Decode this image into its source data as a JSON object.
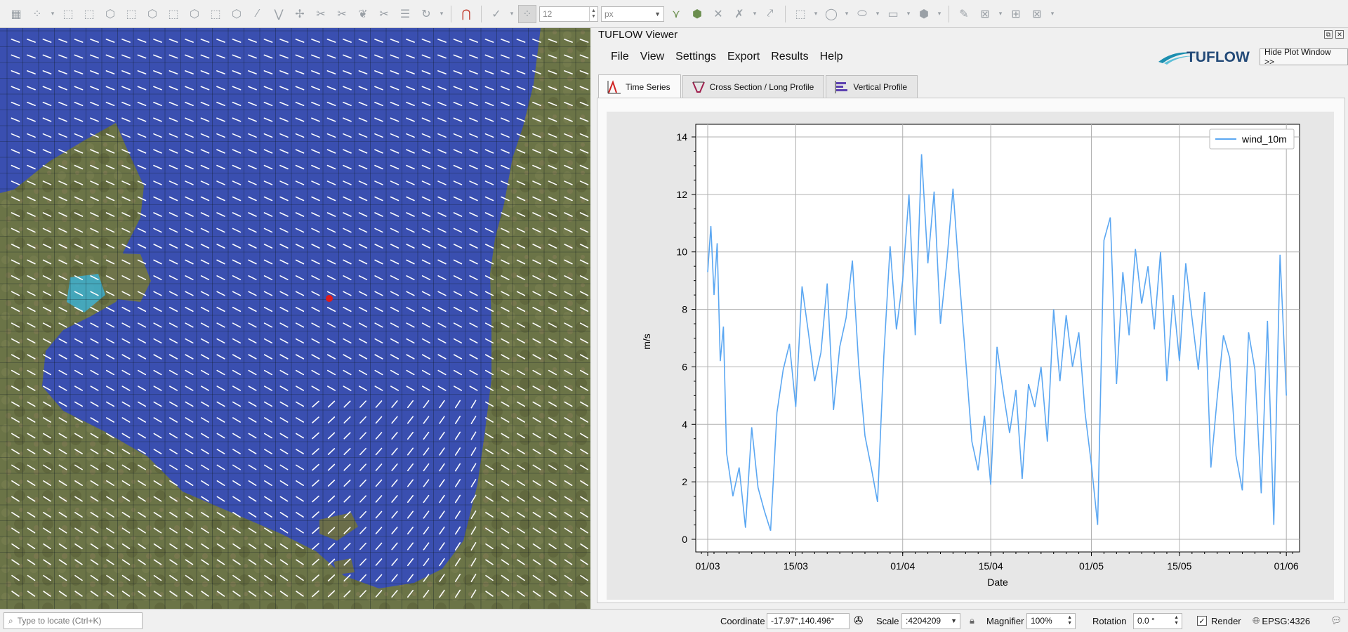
{
  "toolbar": {
    "size_value": "12",
    "unit_value": "px"
  },
  "map": {
    "marker_color": "#e11b1b",
    "water_color": "#3a4fb0",
    "land_color": "#6b7447"
  },
  "viewer": {
    "title": "TUFLOW Viewer",
    "menu": [
      "File",
      "View",
      "Settings",
      "Export",
      "Results",
      "Help"
    ],
    "logo_text": "TUFLOW",
    "hide_plot_label": "Hide Plot Window >>",
    "tabs": [
      {
        "label": "Time Series",
        "active": true,
        "icon": "time-series-icon"
      },
      {
        "label": "Cross Section / Long Profile",
        "active": false,
        "icon": "cross-section-icon"
      },
      {
        "label": "Vertical Profile",
        "active": false,
        "icon": "vertical-profile-icon"
      }
    ]
  },
  "chart_data": {
    "type": "line",
    "xlabel": "Date",
    "ylabel": "m/s",
    "xtick_labels": [
      "01/03",
      "15/03",
      "01/04",
      "15/04",
      "01/05",
      "15/05",
      "01/06"
    ],
    "ylim": [
      0,
      14
    ],
    "yticks": [
      0,
      2,
      4,
      6,
      8,
      10,
      12,
      14
    ],
    "grid": true,
    "legend_position": "top-right",
    "line_color": "#5ba7f2",
    "series": [
      {
        "name": "wind_10m",
        "x_days_from_01_03": [
          0,
          0.5,
          1,
          1.5,
          2,
          2.5,
          3,
          4,
          5,
          6,
          7,
          8,
          9,
          10,
          11,
          12,
          13,
          14,
          15,
          16,
          17,
          18,
          19,
          20,
          21,
          22,
          23,
          24,
          25,
          26,
          27,
          28,
          29,
          30,
          31,
          32,
          33,
          34,
          35,
          36,
          37,
          38,
          39,
          40,
          41,
          42,
          43,
          44,
          45,
          46,
          47,
          48,
          49,
          50,
          51,
          52,
          53,
          54,
          55,
          56,
          57,
          58,
          59,
          60,
          61,
          62,
          63,
          64,
          65,
          66,
          67,
          68,
          69,
          70,
          71,
          72,
          73,
          74,
          75,
          76,
          77,
          78,
          79,
          80,
          81,
          82,
          83,
          84,
          85,
          86,
          87,
          88,
          89,
          90,
          91,
          92
        ],
        "values": [
          9.3,
          10.9,
          8.5,
          10.3,
          6.2,
          7.4,
          3.0,
          1.5,
          2.5,
          0.4,
          3.9,
          1.8,
          1.0,
          0.3,
          4.4,
          5.9,
          6.8,
          4.6,
          8.8,
          7.2,
          5.5,
          6.5,
          8.9,
          4.5,
          6.7,
          7.7,
          9.7,
          6.1,
          3.6,
          2.5,
          1.3,
          6.4,
          10.2,
          7.3,
          9.0,
          12.0,
          7.1,
          13.4,
          9.6,
          12.1,
          7.5,
          9.6,
          12.2,
          9.1,
          6.3,
          3.4,
          2.4,
          4.3,
          1.9,
          6.7,
          5.1,
          3.7,
          5.2,
          2.1,
          5.4,
          4.6,
          6.0,
          3.4,
          8.0,
          5.5,
          7.8,
          6.0,
          7.2,
          4.4,
          2.6,
          0.5,
          10.4,
          11.2,
          5.4,
          9.3,
          7.1,
          10.1,
          8.2,
          9.5,
          7.3,
          10.0,
          5.5,
          8.5,
          6.2,
          9.6,
          7.7,
          5.9,
          8.6,
          2.5,
          4.9,
          7.1,
          6.3,
          2.9,
          1.7,
          7.2,
          5.9,
          1.6,
          7.6,
          0.5,
          9.9,
          5.0
        ]
      }
    ]
  },
  "status": {
    "locator_placeholder": "Type to locate (Ctrl+K)",
    "coordinate_label": "Coordinate",
    "coordinate_value": "-17.97°,140.496°",
    "scale_label": "Scale",
    "scale_value": ":4204209",
    "magnifier_label": "Magnifier",
    "magnifier_value": "100%",
    "rotation_label": "Rotation",
    "rotation_value": "0.0 °",
    "render_label": "Render",
    "render_checked": true,
    "crs_value": "EPSG:4326"
  }
}
